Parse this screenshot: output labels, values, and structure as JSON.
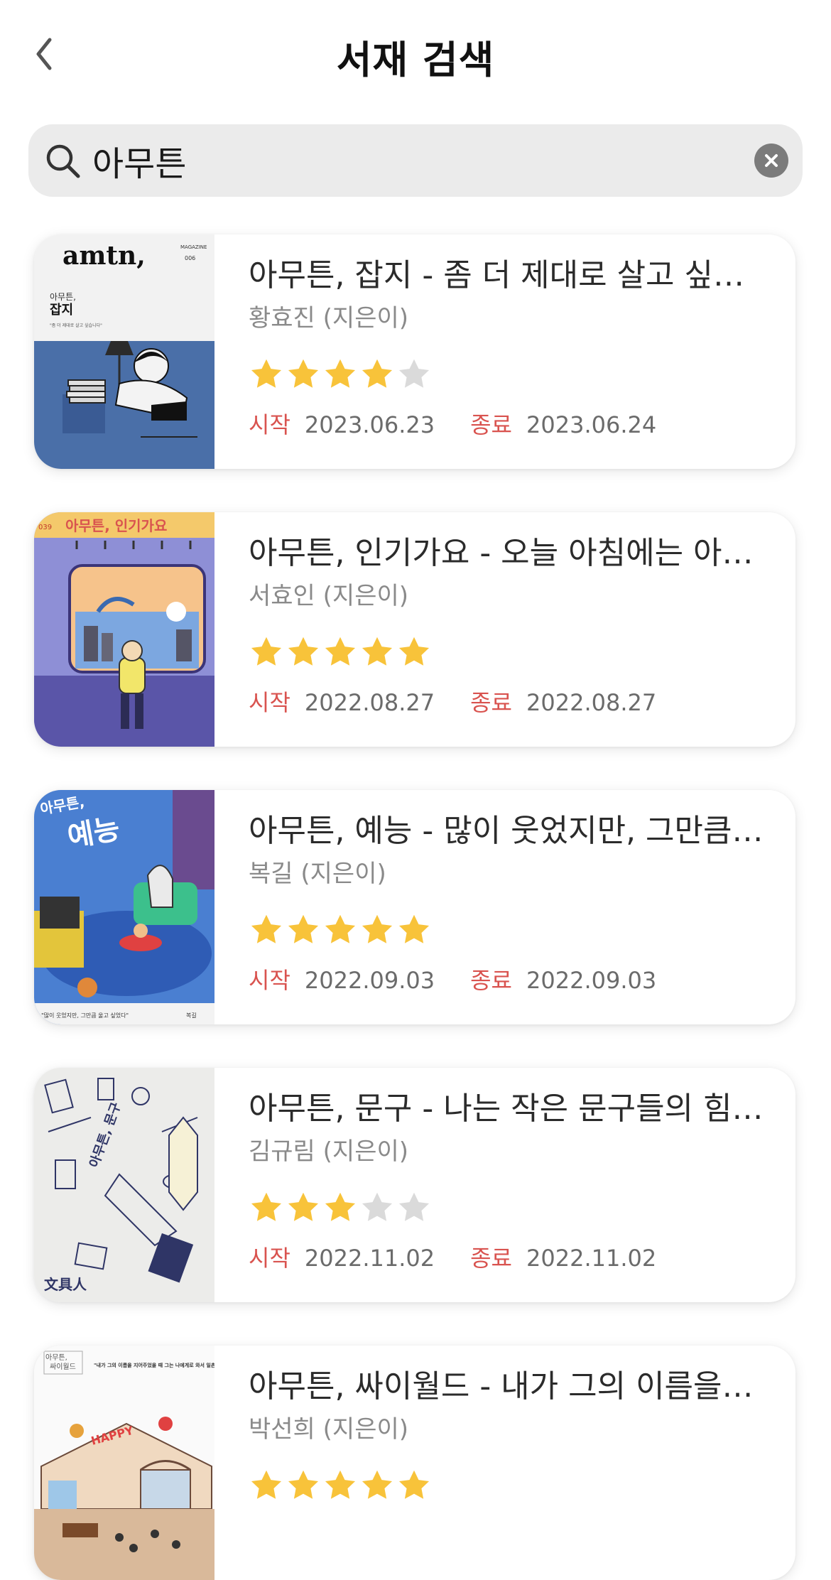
{
  "header": {
    "title": "서재 검색",
    "back_icon": "chevron-left-icon"
  },
  "search": {
    "value": "아무튼",
    "icon": "search-icon",
    "clear_icon": "clear-icon"
  },
  "labels": {
    "start": "시작",
    "end": "종료"
  },
  "colors": {
    "star_filled": "#F8C33A",
    "star_empty": "#DADADA",
    "date_label": "#D9534F",
    "search_bg": "#EBEBEB"
  },
  "books": [
    {
      "title": "아무튼, 잡지 - 좀 더 제대로 살고 싶…",
      "author": "황효진 (지은이)",
      "rating": 4,
      "start": "2023.06.23",
      "end": "2023.06.24",
      "cover": {
        "brand": "amtn,",
        "sub": "MAGAZINE",
        "num": "006",
        "small": "아무튼,",
        "big": "잡지",
        "quote": "\"좀 더 제대로 살고 싶습니다\""
      }
    },
    {
      "title": "아무튼, 인기가요 - 오늘 아침에는 아…",
      "author": "서효인 (지은이)",
      "rating": 5,
      "start": "2022.08.27",
      "end": "2022.08.27",
      "cover": {
        "num": "039",
        "label": "아무튼, 인기가요"
      }
    },
    {
      "title": "아무튼, 예능 - 많이 웃었지만, 그만큼…",
      "author": "복길 (지은이)",
      "rating": 5,
      "start": "2022.09.03",
      "end": "2022.09.03",
      "cover": {
        "small": "아무튼,",
        "big": "예능",
        "quote": "\"많이 웃었지만, 그만큼 울고 싶었다\"",
        "author": "복길"
      }
    },
    {
      "title": "아무튼, 문구 - 나는 작은 문구들의 힘…",
      "author": "김규림 (지은이)",
      "rating": 3,
      "start": "2022.11.02",
      "end": "2022.11.02",
      "cover": {
        "label": "아무튼, 문구",
        "brand": "文具人"
      }
    },
    {
      "title": "아무튼, 싸이월드 - 내가 그의 이름을…",
      "author": "박선희 (지은이)",
      "rating": 5,
      "start": "",
      "end": "",
      "cover": {
        "small": "아무튼,",
        "label": "싸이월드",
        "quote": "\"내가 그의 이름을 지어주었을 때 그는 나에게로 와서 일촌이 되었다\"",
        "happy": "HAPPY"
      }
    }
  ]
}
